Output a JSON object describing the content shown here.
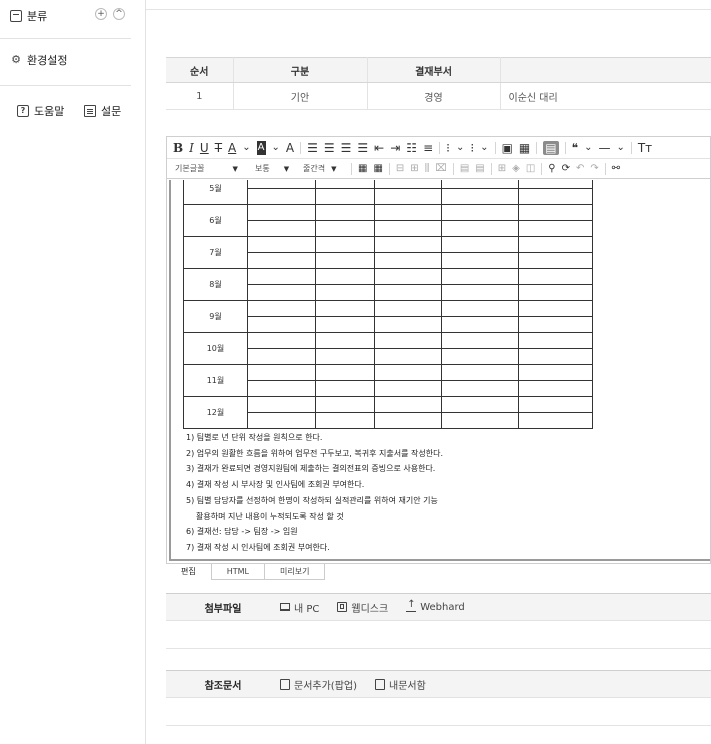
{
  "sidebar": {
    "category": {
      "label": "분류",
      "add": "+",
      "collapse": "^"
    },
    "settings": {
      "label": "환경설정"
    },
    "help": {
      "label": "도움말",
      "icon_glyph": "?"
    },
    "survey": {
      "label": "설문"
    }
  },
  "approval": {
    "headers": [
      "순서",
      "구분",
      "결재부서",
      ""
    ],
    "rows": [
      [
        "1",
        "기안",
        "경영",
        "이순신 대리"
      ]
    ]
  },
  "toolbar": {
    "row1": [
      "B",
      "I",
      "U",
      "T",
      "A",
      "A",
      "A"
    ],
    "font_family": "기본글꼴",
    "font_weight": "보통",
    "line_spacing": "줄간격"
  },
  "months": [
    "5월",
    "6월",
    "7월",
    "8월",
    "9월",
    "10월",
    "11월",
    "12월"
  ],
  "notes": [
    "1) 팀별로 년 단위 작성을 원칙으로 한다.",
    "2) 업무의 원활한 흐름을 위하여 업무전 구두보고, 복귀후 지출서를 작성한다.",
    "3) 결재가 완료되면 경영지원팀에 제출하는 결의전표의 증빙으로 사용한다.",
    "4) 결재 작성 시 부사장 및 인사팀에 조회권 부여한다.",
    "5) 팀별 담당자를 선정하여 한명이 작성하되 실적관리를 위하여 재기안 기능",
    "활용하며 지난 내용이 누적되도록 작성 할 것",
    "6) 결재선: 담당 -> 팀장 -> 임원",
    "7) 결재 작성 시 인사팀에 조회권 부여한다."
  ],
  "mode_tabs": [
    "편집",
    "HTML",
    "미리보기"
  ],
  "attachments": {
    "label": "첨부파일",
    "actions": [
      "내 PC",
      "웹디스크",
      "Webhard"
    ]
  },
  "references": {
    "label": "참조문서",
    "actions": [
      "문서추가(팝업)",
      "내문서함"
    ]
  }
}
